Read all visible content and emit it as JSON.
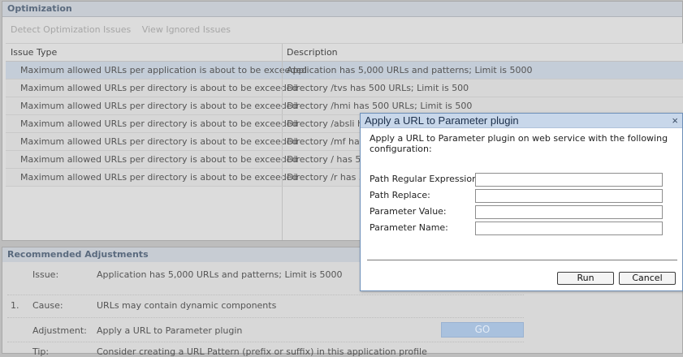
{
  "optimization": {
    "title": "Optimization",
    "toolbar": {
      "detect_label": "Detect Optimization Issues",
      "ignored_label": "View Ignored Issues"
    },
    "columns": {
      "issue_type": "Issue Type",
      "description": "Description"
    },
    "rows": [
      {
        "issue": "Maximum allowed URLs per application is about to be exceeded",
        "description": "Application has 5,000 URLs and patterns; Limit is 5000"
      },
      {
        "issue": "Maximum allowed URLs per directory is about to be exceeded",
        "description": "Directory /tvs has 500 URLs; Limit is 500"
      },
      {
        "issue": "Maximum allowed URLs per directory is about to be exceeded",
        "description": "Directory /hmi has 500 URLs; Limit is 500"
      },
      {
        "issue": "Maximum allowed URLs per directory is about to be exceeded",
        "description": "Directory /absli has"
      },
      {
        "issue": "Maximum allowed URLs per directory is about to be exceeded",
        "description": "Directory /mf has 5"
      },
      {
        "issue": "Maximum allowed URLs per directory is about to be exceeded",
        "description": "Directory / has 500"
      },
      {
        "issue": "Maximum allowed URLs per directory is about to be exceeded",
        "description": "Directory /r has 50"
      }
    ]
  },
  "recommended": {
    "title": "Recommended Adjustments",
    "issue_label": "Issue:",
    "issue_value": "Application has 5,000 URLs and patterns; Limit is 5000",
    "item_number": "1.",
    "cause_label": "Cause:",
    "cause_value": "URLs may contain dynamic components",
    "adjustment_label": "Adjustment:",
    "adjustment_value": "Apply a URL to Parameter plugin",
    "go_label": "GO",
    "tip_label": "Tip:",
    "tip_value": "Consider creating a URL Pattern (prefix or suffix) in this application profile"
  },
  "dialog": {
    "title": "Apply a URL to Parameter plugin",
    "close_glyph": "×",
    "message": "Apply a URL to Parameter plugin on web service with the following configuration:",
    "fields": {
      "path_regex_label": "Path Regular Expression:",
      "path_replace_label": "Path Replace:",
      "param_value_label": "Parameter Value:",
      "param_name_label": "Parameter Name:"
    },
    "run_label": "Run",
    "cancel_label": "Cancel"
  }
}
